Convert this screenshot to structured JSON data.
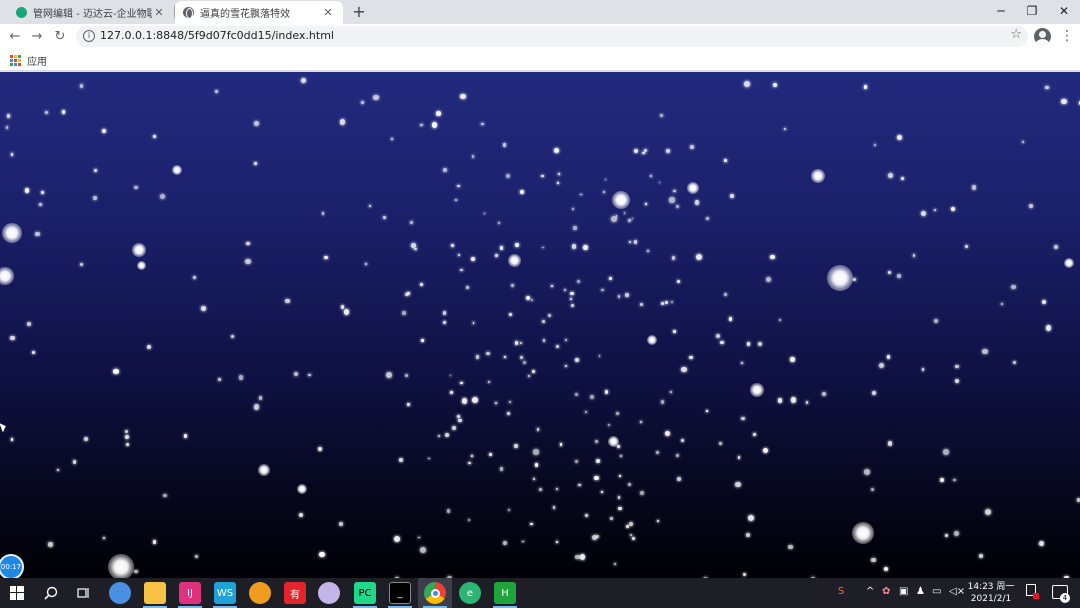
{
  "browser": {
    "tabs": [
      {
        "title": "管网编辑 - 迈达云-企业物联网时",
        "active": false
      },
      {
        "title": "逼真的雪花飘落特效",
        "active": true
      }
    ],
    "new_tab_symbol": "+",
    "window_controls": {
      "minimize": "─",
      "restore": "❐",
      "close": "✕"
    },
    "address": "127.0.0.1:8848/5f9d07fc0dd15/index.html",
    "bookmarks": {
      "apps_label": "应用"
    }
  },
  "scene": {
    "background_top": "#222a7e",
    "background_bottom": "#000005",
    "flake_color": "#ffffff",
    "timer_label": "00:17"
  },
  "taskbar": {
    "clock": {
      "time": "14:23 周一",
      "date": "2021/2/1"
    },
    "notification_count": "4",
    "apps": [
      {
        "name": "start-icon",
        "color": "#ffffff"
      },
      {
        "name": "search-icon",
        "color": "#ffffff"
      },
      {
        "name": "task-view-icon",
        "color": "#ffffff"
      },
      {
        "name": "browser-ie-icon",
        "color": "#4a90e2"
      },
      {
        "name": "file-explorer-icon",
        "color": "#f6c244"
      },
      {
        "name": "intellij-icon",
        "color": "#e0317d"
      },
      {
        "name": "webstorm-icon",
        "color": "#20a1d8"
      },
      {
        "name": "app-orange-icon",
        "color": "#f29c1f"
      },
      {
        "name": "youdao-icon",
        "color": "#e3242b"
      },
      {
        "name": "app-color-icon",
        "color": "#c4b5e8"
      },
      {
        "name": "pycharm-icon",
        "color": "#21d789"
      },
      {
        "name": "terminal-icon",
        "color": "#000000"
      },
      {
        "name": "chrome-icon",
        "color": "#4285f4"
      },
      {
        "name": "app-green-icon",
        "color": "#2bb673"
      },
      {
        "name": "hbuilder-icon",
        "color": "#1fa33b"
      }
    ]
  }
}
